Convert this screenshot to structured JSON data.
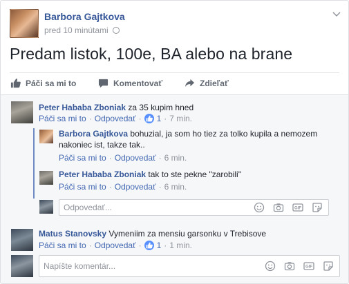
{
  "post": {
    "author": "Barbora Gajtkova",
    "time": "pred 10 minútami",
    "privacy_icon": "globe-icon",
    "text": "Predam listok, 100e, BA alebo na brane"
  },
  "actions": {
    "like": "Páči sa mi to",
    "comment": "Komentovať",
    "share": "Zdieľať"
  },
  "comments": [
    {
      "author": "Peter Hababa Zboniak",
      "text": "za 35 kupim hned",
      "like": "Páči sa mi to",
      "reply": "Odpovedať",
      "likes": "1",
      "time": "7 min.",
      "replies": [
        {
          "author": "Barbora Gajtkova",
          "text_line1": "bohuzial, ja som ho tiez za tolko kupila a nemozem",
          "text_line2": "nakoniec ist, takze tak..",
          "like": "Páči sa mi to",
          "reply": "Odpovedať",
          "time": "6 min."
        },
        {
          "author": "Peter Hababa Zboniak",
          "text": "tak to ste pekne \"zarobili\"",
          "like": "Páči sa mi to",
          "reply": "Odpovedať",
          "time": "6 min."
        }
      ],
      "reply_placeholder": "Odpovedať..."
    },
    {
      "author": "Matus Stanovsky",
      "text": "Vymeniim za mensiu garsonku v Trebisove",
      "like": "Páči sa mi to",
      "reply": "Odpovedať",
      "likes": "1",
      "time": "1 min."
    }
  ],
  "composer": {
    "placeholder": "Napíšte komentár...",
    "icons": [
      "smiley-icon",
      "camera-icon",
      "gif-icon",
      "sticker-icon"
    ]
  },
  "colors": {
    "link": "#4267b2",
    "name": "#365899",
    "meta": "#90949c",
    "comments_bg": "#f6f7f9"
  }
}
